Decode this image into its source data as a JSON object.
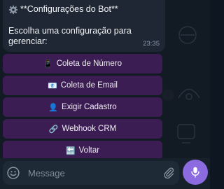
{
  "message": {
    "title": "**Configurações do Bot**",
    "body_line1": "Escolha uma configuração para",
    "body_line2": "gerenciar:",
    "time": "23:35"
  },
  "keyboard": [
    {
      "icon": "📱",
      "label": "Coleta de Número"
    },
    {
      "icon": "📧",
      "label": "Coleta de Email"
    },
    {
      "icon": "👤",
      "label": "Exigir Cadastro"
    },
    {
      "icon": "🔗",
      "label": "Webhook CRM"
    },
    {
      "icon": "🔙",
      "label": "Voltar"
    }
  ],
  "composer": {
    "placeholder": "Message"
  },
  "colors": {
    "bubble": "#1e2733",
    "keyboard_button": "#3b1d53",
    "mic_button": "#8b6bdf"
  }
}
